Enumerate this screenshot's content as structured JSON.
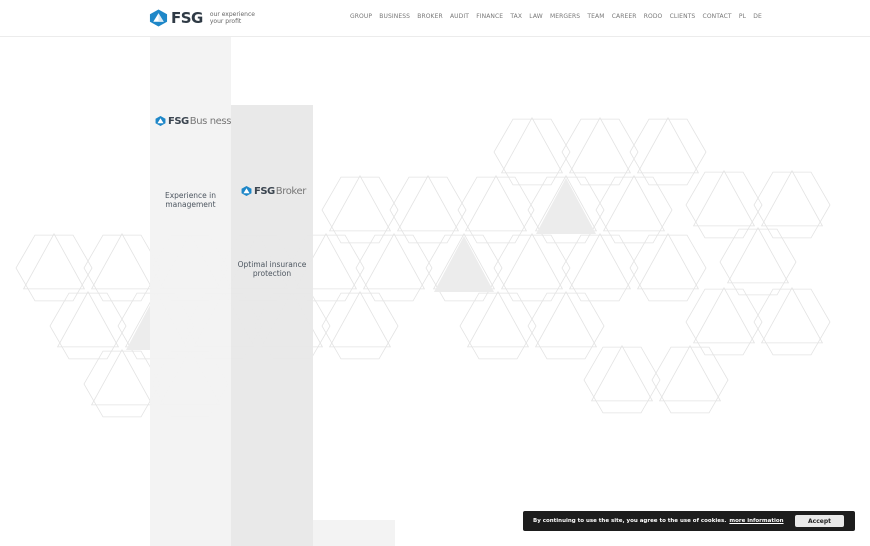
{
  "header": {
    "logo_text": "FSG",
    "tagline_line1": "our experience",
    "tagline_line2": "your profit",
    "nav": [
      "GROUP",
      "BUSINESS",
      "BROKER",
      "AUDIT",
      "FINANCE",
      "TAX",
      "LAW",
      "MERGERS",
      "TEAM",
      "CAREER",
      "RODO",
      "CLIENTS",
      "CONTACT",
      "PL",
      "DE"
    ]
  },
  "panels": {
    "business": {
      "brand": "FSG",
      "sub": "Bus ness",
      "desc_line1": "Experience in",
      "desc_line2": "management"
    },
    "broker": {
      "brand": "FSG",
      "sub": "Broker",
      "desc_line1": "Optimal insurance",
      "desc_line2": "protection"
    }
  },
  "cookie": {
    "text": "By continuing to use the site, you agree to the use of cookies.",
    "link": "more information",
    "button": "Accept"
  },
  "colors": {
    "logo_blue": "#1e87c8",
    "logo_dark": "#2f3a45",
    "cookie_bg": "#1d1d1d"
  }
}
